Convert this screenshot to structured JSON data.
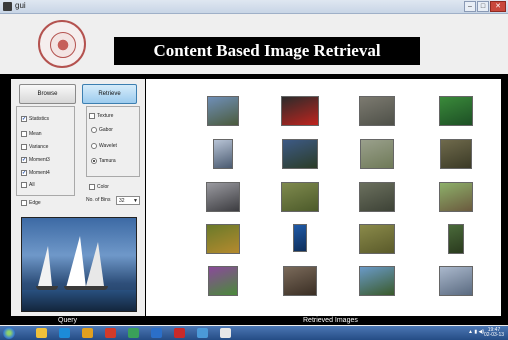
{
  "window": {
    "title": "gui"
  },
  "header": {
    "banner_title": "Content Based Image Retrieval"
  },
  "buttons": {
    "browse": "Browse",
    "retrieve": "Retrieve"
  },
  "features": {
    "statistics": {
      "label": "Statistics",
      "checked": true
    },
    "mean": {
      "label": "Mean",
      "checked": false
    },
    "variance": {
      "label": "Variance",
      "checked": false
    },
    "moment3": {
      "label": "Moment3",
      "checked": true
    },
    "moment4": {
      "label": "Moment4",
      "checked": true
    },
    "all": {
      "label": "All",
      "checked": false
    },
    "edge": {
      "label": "Edge",
      "checked": false
    },
    "texture": {
      "label": "Texture",
      "checked": false
    },
    "gabor": {
      "label": "Gabor",
      "selected": false
    },
    "wavelet": {
      "label": "Wavelet",
      "selected": false
    },
    "tamura": {
      "label": "Tamura",
      "selected": true
    },
    "color": {
      "label": "Color",
      "checked": false
    },
    "bins_label": "No. of Bins",
    "bins_value": "32"
  },
  "captions": {
    "query": "Query",
    "retrieved": "Retrieved Images"
  },
  "thumbnails": [
    {
      "name": "mountain-lake",
      "c1": "#6f8fb8",
      "c2": "#4b5b3c"
    },
    {
      "name": "red-car",
      "c1": "#2b2b2b",
      "c2": "#c0241e"
    },
    {
      "name": "rock-pile",
      "c1": "#7c7a70",
      "c2": "#4e5048"
    },
    {
      "name": "green-scene",
      "c1": "#3a8a3a",
      "c2": "#1d4f25"
    },
    {
      "name": "building-small",
      "c1": "#b8c4d6",
      "c2": "#4a5a70"
    },
    {
      "name": "coastline",
      "c1": "#3d5a86",
      "c2": "#2b3c27"
    },
    {
      "name": "plants",
      "c1": "#9aa08c",
      "c2": "#6f7a58"
    },
    {
      "name": "bushes",
      "c1": "#6f6a4c",
      "c2": "#3b3a26"
    },
    {
      "name": "indoor-objects",
      "c1": "#9a9aa0",
      "c2": "#3c3c40"
    },
    {
      "name": "grass-field",
      "c1": "#7f8a4e",
      "c2": "#4c5a2a"
    },
    {
      "name": "rock-wall",
      "c1": "#6b705e",
      "c2": "#3d4236"
    },
    {
      "name": "house",
      "c1": "#8db06a",
      "c2": "#6b5a3e"
    },
    {
      "name": "autumn-tree",
      "c1": "#6a7a2a",
      "c2": "#b58a2e"
    },
    {
      "name": "waterfall",
      "c1": "#1f5aa8",
      "c2": "#0e2e5a"
    },
    {
      "name": "field-plain",
      "c1": "#8a8a4a",
      "c2": "#5a5a2a"
    },
    {
      "name": "tall-tree",
      "c1": "#4a6a3a",
      "c2": "#2a3a1e"
    },
    {
      "name": "flowers",
      "c1": "#8a4a9a",
      "c2": "#4a8a3a"
    },
    {
      "name": "people",
      "c1": "#7a6a5a",
      "c2": "#3a2e24"
    },
    {
      "name": "trees-sky",
      "c1": "#6a9ac8",
      "c2": "#3a5a2a"
    },
    {
      "name": "clouds",
      "c1": "#aab8cc",
      "c2": "#5a6a80"
    }
  ],
  "taskbar_colors": [
    "#f0c13a",
    "#1c8bd8",
    "#e0a020",
    "#d23a2a",
    "#3aa05a",
    "#2b6fc9",
    "#c82a2a",
    "#4b9ad8",
    "#e8e8e8"
  ],
  "clock": {
    "time": "19:47",
    "date": "02-03-13"
  }
}
